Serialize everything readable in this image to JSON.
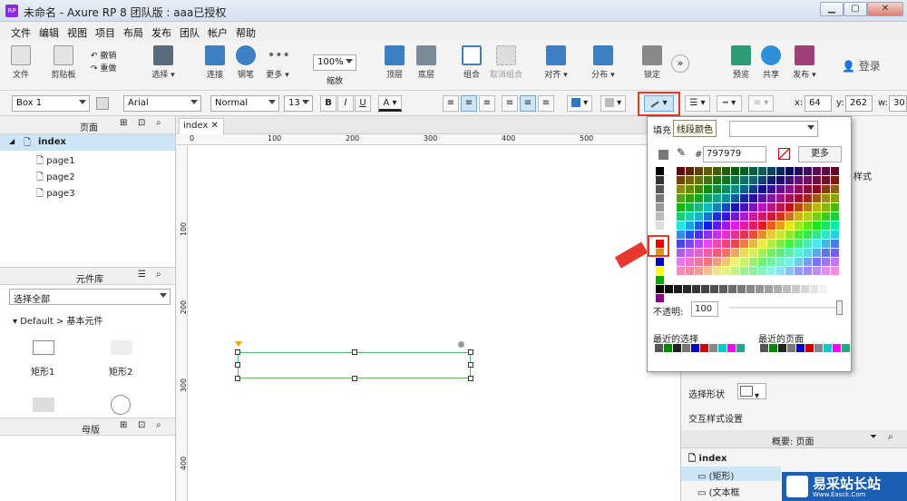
{
  "window": {
    "title": "未命名 - Axure RP 8 团队版 : aaa已授权",
    "app_icon": "RP"
  },
  "menu": [
    "文件",
    "编辑",
    "视图",
    "项目",
    "布局",
    "发布",
    "团队",
    "帐户",
    "帮助"
  ],
  "toolbar1": {
    "undo": "撤销",
    "redo": "重做",
    "select": "选择",
    "connect": "连接",
    "pen": "钢笔",
    "more": "更多",
    "file": "文件",
    "clipboard": "剪贴板",
    "zoom_value": "100%",
    "zoom_label": "缩放",
    "top": "顶层",
    "bottom": "底层",
    "group": "组合",
    "ungroup": "取消组合",
    "align": "对齐",
    "distribute": "分布",
    "lock": "锁定",
    "preview": "预览",
    "share": "共享",
    "publish": "发布",
    "login": "登录"
  },
  "toolbar2": {
    "widget_name": "Box 1",
    "font_family": "Arial",
    "font_style": "Normal",
    "font_size": "13",
    "bold": "B",
    "italic": "I",
    "underline": "U",
    "text_color_label": "A",
    "x_label": "x:",
    "x_value": "64",
    "y_label": "y:",
    "y_value": "262",
    "w_label": "w:",
    "w_value": "30"
  },
  "pages_panel": {
    "title": "页面",
    "items": [
      "index",
      "page1",
      "page2",
      "page3"
    ]
  },
  "library_panel": {
    "title": "元件库",
    "select": "选择全部",
    "group": "Default > 基本元件",
    "items": [
      "矩形1",
      "矩形2"
    ]
  },
  "masters_panel": {
    "title": "母版"
  },
  "canvas": {
    "tab": "index",
    "ruler_h": [
      "0",
      "100",
      "200",
      "300",
      "400",
      "500"
    ],
    "ruler_v": [
      "100",
      "200",
      "300",
      "400"
    ]
  },
  "color_popup": {
    "fill_label": "填充",
    "tooltip": "线段颜色",
    "hex_prefix": "#",
    "hex_value": "797979",
    "more": "更多",
    "opacity_label": "不透明:",
    "opacity_value": "100",
    "recent_label": "最近的选择",
    "recent_page_label": "最近的页面"
  },
  "right_panel": {
    "style_tab": "样式",
    "select_shape": "选择形状",
    "interaction_style": "交互样式设置",
    "outline_title": "概要: 页面",
    "outline_items": [
      "index",
      "(矩形)",
      "(文本框"
    ]
  },
  "watermark": {
    "text": "易采站长站",
    "sub": "Www.Easck.Com"
  },
  "colors": {
    "accent": "#e8382e",
    "selection_blue": "#cde6f7",
    "popup_highlight": "#e8382e",
    "hex": "#797979"
  }
}
